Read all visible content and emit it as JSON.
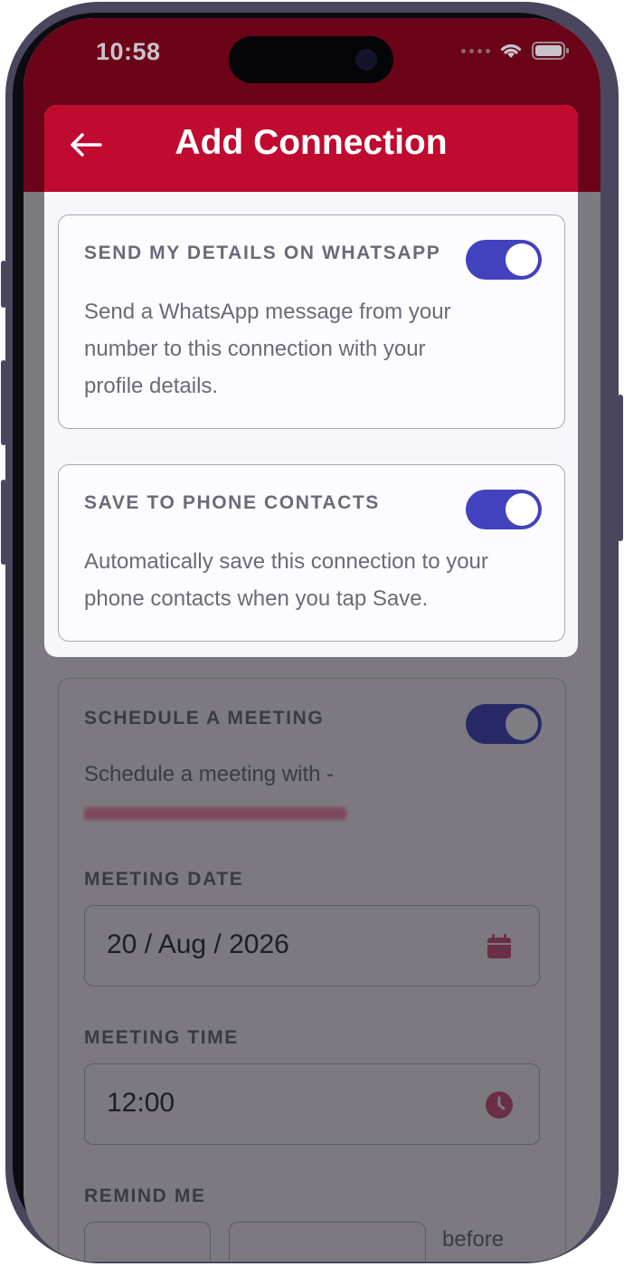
{
  "status_bar": {
    "time": "10:58"
  },
  "header": {
    "title": "Add Connection"
  },
  "options": [
    {
      "title": "SEND MY DETAILS ON WHATSAPP",
      "description_lines": [
        "Send a WhatsApp message from your",
        "number to this connection with your",
        "profile details."
      ],
      "enabled": true
    },
    {
      "title": "SAVE TO PHONE CONTACTS",
      "description_lines": [
        "Automatically save this connection to your",
        "phone contacts when you tap Save."
      ],
      "enabled": true
    }
  ],
  "meeting": {
    "title": "SCHEDULE A MEETING",
    "enabled": true,
    "description": "Schedule a meeting with -",
    "date_label": "MEETING DATE",
    "date_value": "20 / Aug / 2026",
    "time_label": "MEETING TIME",
    "time_value": "12:00",
    "remind_label": "REMIND ME",
    "remind_suffix": "before"
  },
  "colors": {
    "header_red": "#c00a2f",
    "toggle_on": "#4242bf",
    "status_band": "#6b0319"
  },
  "icons": [
    "back-arrow-icon",
    "wifi-icon",
    "battery-icon",
    "calendar-icon",
    "clock-icon"
  ]
}
